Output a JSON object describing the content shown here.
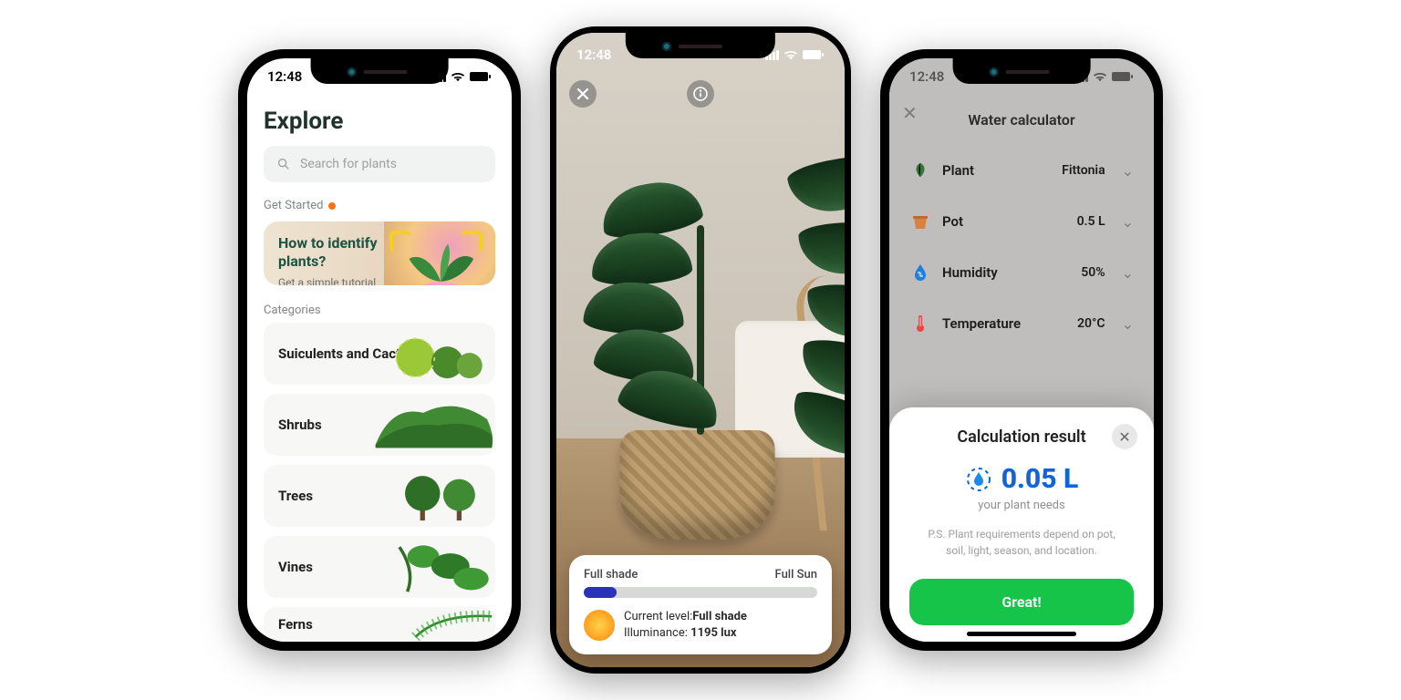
{
  "statusbar": {
    "time": "12:48"
  },
  "explore": {
    "title": "Explore",
    "search_placeholder": "Search for plants",
    "get_started_label": "Get Started",
    "tutorial": {
      "title": "How to identify plants?",
      "subtitle": "Get a simple tutorial"
    },
    "categories_label": "Categories",
    "categories": [
      {
        "name": "Suiculents and Cacti"
      },
      {
        "name": "Shrubs"
      },
      {
        "name": "Trees"
      },
      {
        "name": "Vines"
      },
      {
        "name": "Ferns"
      }
    ]
  },
  "lightmeter": {
    "min_label": "Full shade",
    "max_label": "Full Sun",
    "level_prefix": "Current level:",
    "level_value": "Full shade",
    "illuminance_prefix": "Illuminance:",
    "illuminance_value": "1195 lux"
  },
  "water": {
    "title": "Water calculator",
    "rows": {
      "plant": {
        "label": "Plant",
        "value": "Fittonia"
      },
      "pot": {
        "label": "Pot",
        "value": "0.5 L"
      },
      "humidity": {
        "label": "Humidity",
        "value": "50%"
      },
      "temperature": {
        "label": "Temperature",
        "value": "20°C"
      }
    },
    "result": {
      "heading": "Calculation result",
      "value": "0.05 L",
      "subtitle": "your plant needs",
      "note": "P.S. Plant requirements depend on pot, soil, light, season, and location.",
      "cta": "Great!"
    }
  }
}
